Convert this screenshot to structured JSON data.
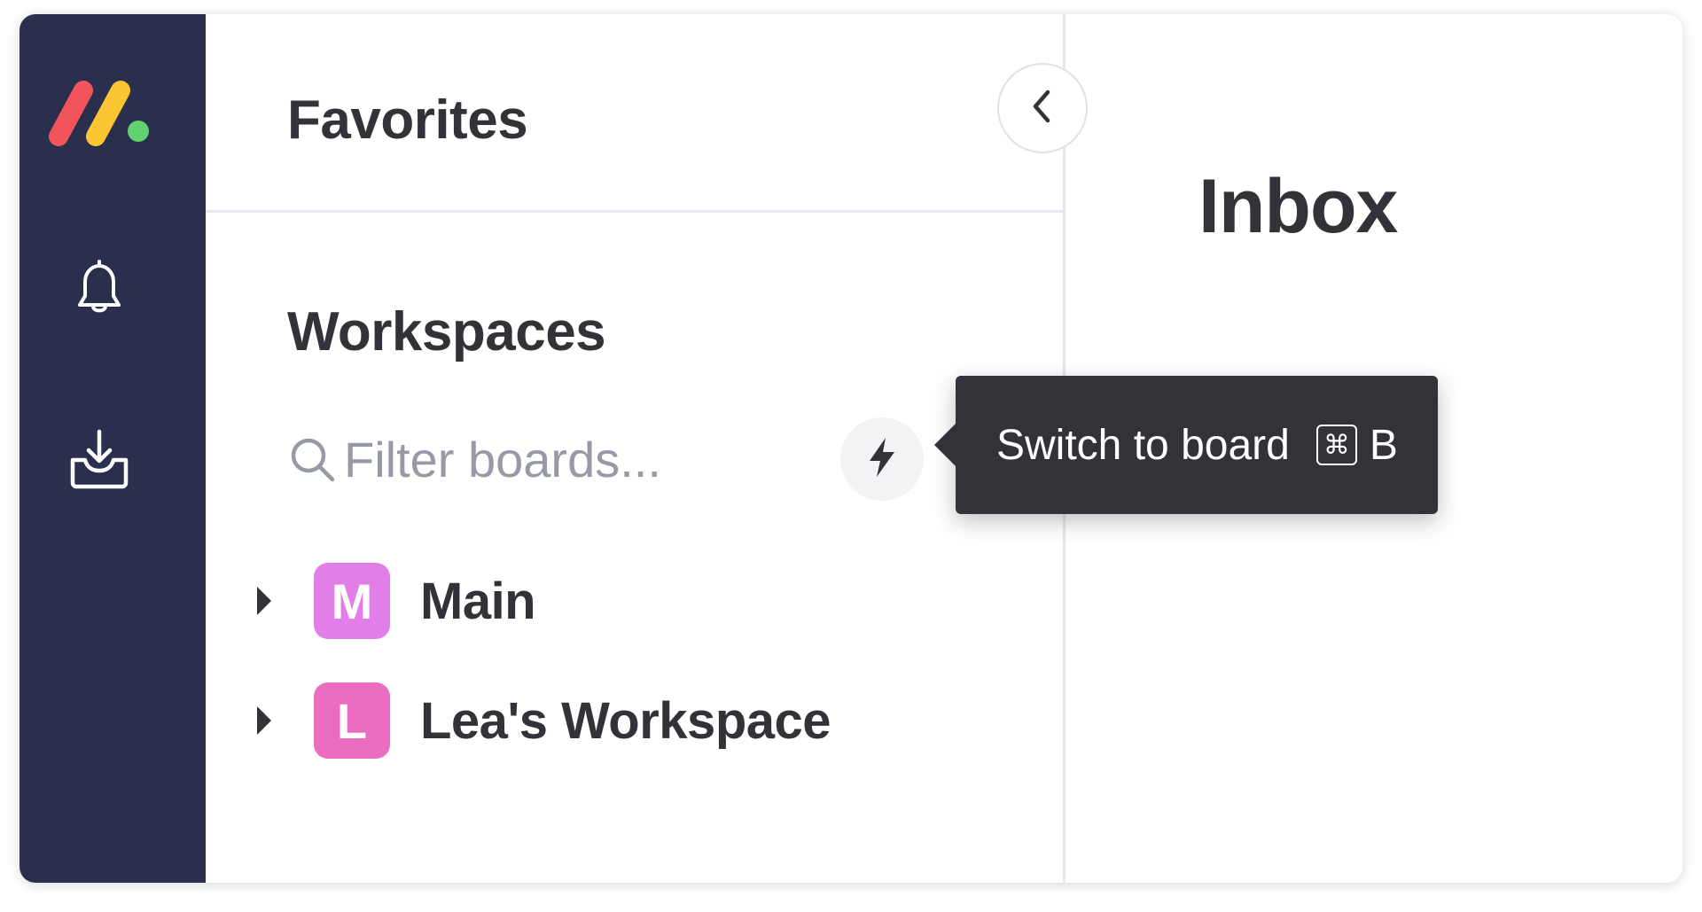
{
  "colors": {
    "rail_background": "#292f4c",
    "text_primary": "#323338",
    "text_placeholder": "#9699a6",
    "tooltip_background": "#323338",
    "main_workspace": "#e17ee7",
    "lea_workspace": "#eb6cc1",
    "logo_red": "#f2545b",
    "logo_yellow": "#fcc533",
    "logo_green": "#62d26f"
  },
  "rail": {
    "logo_icon": "monday-logo-icon",
    "items": [
      {
        "icon": "bell-icon",
        "name": "notifications"
      },
      {
        "icon": "inbox-download-icon",
        "name": "inbox"
      }
    ]
  },
  "panel": {
    "favorites_label": "Favorites",
    "workspaces_label": "Workspaces",
    "collapse_icon": "chevron-left-icon",
    "search": {
      "placeholder": "Filter boards...",
      "icon": "search-icon"
    },
    "quick_switch_icon": "lightning-icon",
    "workspaces": [
      {
        "letter": "M",
        "name": "Main"
      },
      {
        "letter": "L",
        "name": "Lea's Workspace"
      }
    ]
  },
  "inbox": {
    "title": "Inbox"
  },
  "tooltip": {
    "text": "Switch to board",
    "shortcut_modifier": "⌘",
    "shortcut_key": "B"
  }
}
